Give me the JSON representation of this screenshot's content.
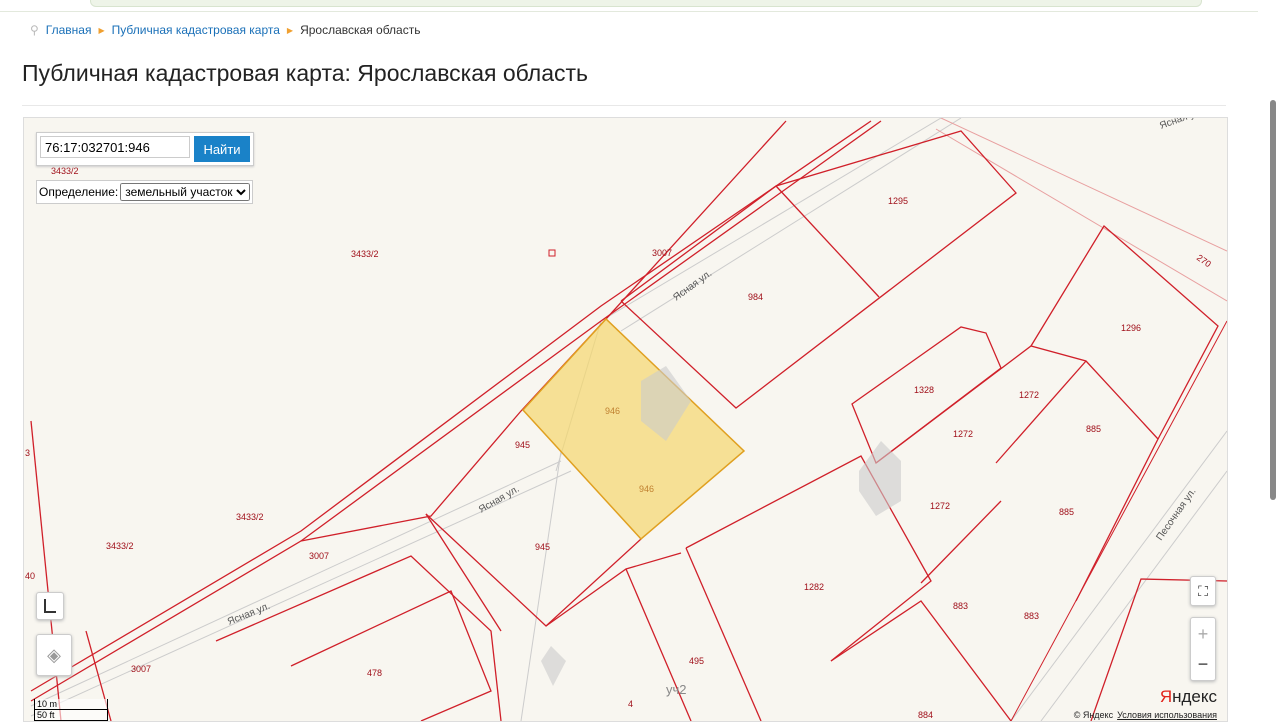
{
  "breadcrumb": [
    "Главная",
    "Публичная кадастровая карта",
    "Ярославская область"
  ],
  "page_title": "Публичная кадастровая карта: Ярославская область",
  "search": {
    "value": "76:17:032701:946",
    "button": "Найти"
  },
  "definition": {
    "label": "Определение:",
    "selected": "земельный участок"
  },
  "map": {
    "parcel_labels": [
      "3433/2",
      "3433/2",
      "3433/2",
      "3433/2",
      "3007",
      "3007",
      "3007",
      "984",
      "1295",
      "1296",
      "1328",
      "1272",
      "1272",
      "1272",
      "885",
      "885",
      "945",
      "945",
      "946",
      "946",
      "1282",
      "883",
      "883",
      "478",
      "495",
      "4",
      "884",
      "270",
      "3",
      "40"
    ],
    "road_labels": [
      "Ясная ул.",
      "Ясная ул.",
      "Ясная ул.",
      "Ясная ул.",
      "Песочная ул.",
      "уч2"
    ],
    "selected_color": "#f5d76e",
    "boundary_color": "#d0202a"
  },
  "controls": {
    "fullscreen": "⛶",
    "zoom_in": "+",
    "zoom_out": "−"
  },
  "scale": {
    "m": "10 m",
    "ft": "50 ft"
  },
  "attribution": {
    "brand_a": "Я",
    "brand_b": "ндекс",
    "copyright": "© Яндекс",
    "terms": "Условия использования"
  }
}
